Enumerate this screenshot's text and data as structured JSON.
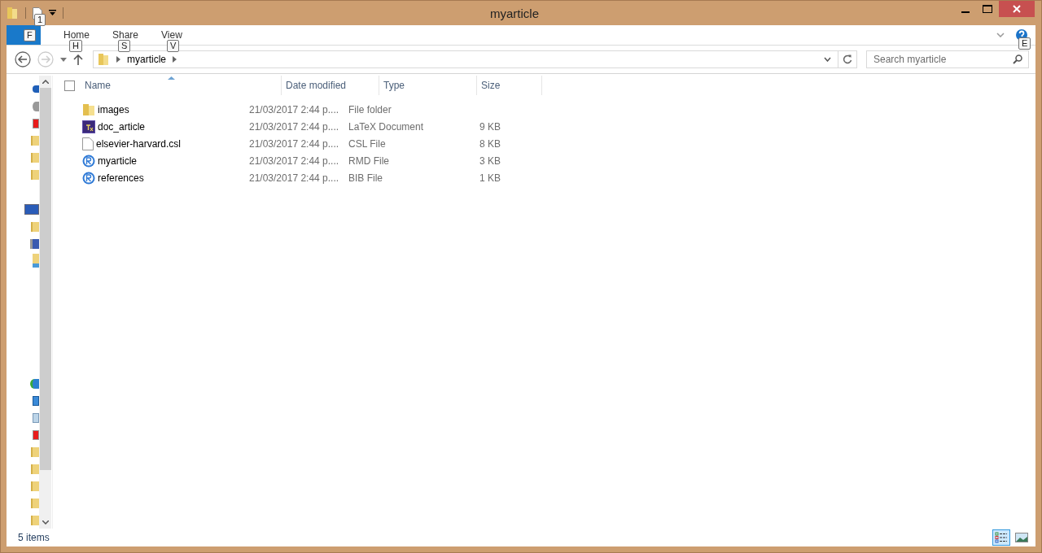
{
  "window": {
    "title": "myarticle"
  },
  "quick_access": {
    "keytip": "1"
  },
  "ribbon": {
    "file_tab": {
      "keytip": "F"
    },
    "tabs": [
      {
        "label": "Home",
        "keytip": "H",
        "selected": false
      },
      {
        "label": "Share",
        "keytip": "S",
        "selected": false
      },
      {
        "label": "View",
        "keytip": "V",
        "selected": false
      }
    ],
    "help_keytip": "E"
  },
  "address_bar": {
    "path": [
      "myarticle"
    ]
  },
  "search": {
    "placeholder": "Search myarticle"
  },
  "table": {
    "select_all": {
      "checked": false
    },
    "columns": [
      "Name",
      "Date modified",
      "Type",
      "Size"
    ],
    "rows": [
      {
        "kind": "folder",
        "name": "images",
        "date": "21/03/2017 2:44 p....",
        "type": "File folder",
        "size": ""
      },
      {
        "kind": "tex",
        "name": "doc_article",
        "date": "21/03/2017 2:44 p....",
        "type": "LaTeX Document",
        "size": "9 KB"
      },
      {
        "kind": "file",
        "name": "elsevier-harvard.csl",
        "date": "21/03/2017 2:44 p....",
        "type": "CSL File",
        "size": "8 KB"
      },
      {
        "kind": "r",
        "name": "myarticle",
        "date": "21/03/2017 2:44 p....",
        "type": "RMD File",
        "size": "3 KB"
      },
      {
        "kind": "r",
        "name": "references",
        "date": "21/03/2017 2:44 p....",
        "type": "BIB File",
        "size": "1 KB"
      }
    ]
  },
  "status_bar": {
    "count": "5 items"
  }
}
